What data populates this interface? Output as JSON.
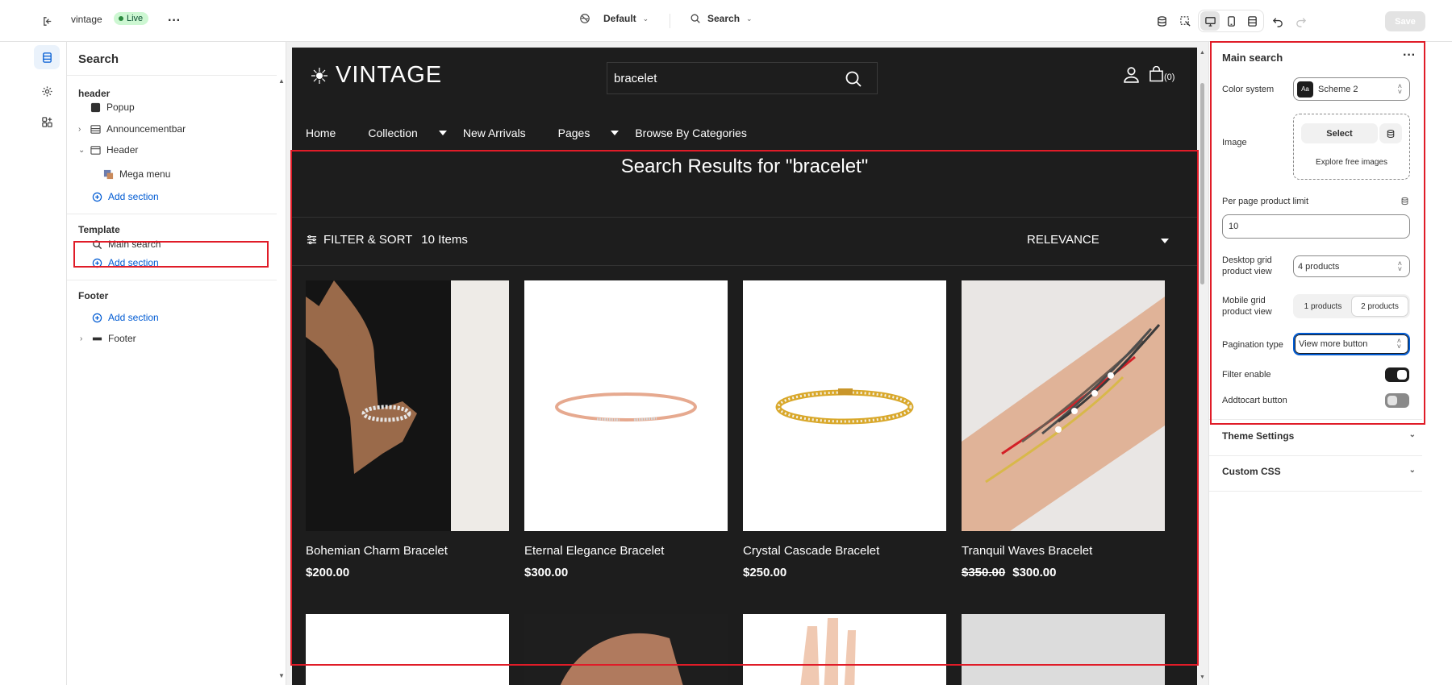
{
  "topbar": {
    "store_name": "vintage",
    "status": "Live",
    "theme_selector": "Default",
    "page_selector": "Search",
    "save_label": "Save"
  },
  "sidebar": {
    "title": "Search",
    "header_group": "header",
    "header_items": [
      "Popup",
      "Announcementbar",
      "Header",
      "Mega menu"
    ],
    "template_group": "Template",
    "template_items": [
      "Main search"
    ],
    "footer_group": "Footer",
    "footer_items": [
      "Footer"
    ],
    "add_section": "Add section"
  },
  "store": {
    "logo": "VINTAGE",
    "search_value": "bracelet",
    "cart_count": "(0)",
    "nav": [
      "Home",
      "Collection",
      "New Arrivals",
      "Pages",
      "Browse By Categories"
    ],
    "results_title": "Search Results for \"bracelet\"",
    "filter_label": "FILTER & SORT",
    "item_count": "10 Items",
    "sort_label": "RELEVANCE",
    "products": [
      {
        "name": "Bohemian Charm Bracelet",
        "price": "$200.00",
        "old_price": ""
      },
      {
        "name": "Eternal Elegance Bracelet",
        "price": "$300.00",
        "old_price": ""
      },
      {
        "name": "Crystal Cascade Bracelet",
        "price": "$250.00",
        "old_price": ""
      },
      {
        "name": "Tranquil Waves Bracelet",
        "price": "$300.00",
        "old_price": "$350.00"
      }
    ]
  },
  "settings": {
    "title": "Main search",
    "color_system_label": "Color system",
    "color_system_value": "Scheme 2",
    "color_swatch_text": "Aa",
    "image_label": "Image",
    "select_label": "Select",
    "explore_label": "Explore free images",
    "per_page_label": "Per page product limit",
    "per_page_value": "10",
    "desktop_grid_label_1": "Desktop grid",
    "desktop_grid_label_2": "product view",
    "desktop_grid_value": "4 products",
    "mobile_grid_label_1": "Mobile grid",
    "mobile_grid_label_2": "product view",
    "mobile_option_1": "1 products",
    "mobile_option_2": "2 products",
    "pagination_label": "Pagination type",
    "pagination_value": "View more button",
    "filter_enable_label": "Filter enable",
    "filter_enable_on": true,
    "addtocart_label": "Addtocart button",
    "addtocart_on": false,
    "theme_settings": "Theme Settings",
    "custom_css": "Custom CSS"
  },
  "colors": {
    "accent_blue": "#005bd3",
    "highlight_red": "#e01c28",
    "live_green": "#cdf7d2",
    "store_bg": "#1d1d1d"
  }
}
